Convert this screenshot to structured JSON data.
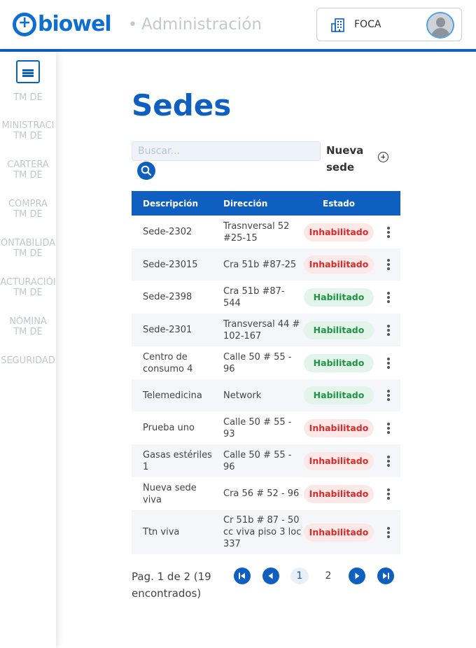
{
  "header": {
    "logo_text": "biowel",
    "section": "Administración",
    "org_name": "FOCA"
  },
  "sidebar": {
    "items": [
      {
        "l1": "TM DE",
        "l2": ""
      },
      {
        "l1": "MINISTRACI",
        "l2": "TM DE"
      },
      {
        "l1": "CARTERA",
        "l2": "TM DE"
      },
      {
        "l1": "COMPRA",
        "l2": "TM DE"
      },
      {
        "l1": "ONTABILIDA",
        "l2": "TM DE"
      },
      {
        "l1": "ACTURACIÓI",
        "l2": "TM DE"
      },
      {
        "l1": "NÓMINA",
        "l2": "TM DE"
      },
      {
        "l1": "SEGURIDAD",
        "l2": ""
      }
    ]
  },
  "page": {
    "title": "Sedes",
    "search_placeholder": "Buscar...",
    "new_label": "Nueva sede"
  },
  "table": {
    "columns": [
      "Descripción",
      "Dirección",
      "Estado"
    ],
    "rows": [
      {
        "desc": "Sede-2302",
        "dir": "Trasnversal 52 #25-15",
        "estado": "Inhabilitado"
      },
      {
        "desc": "Sede-23015",
        "dir": "Cra 51b #87-25",
        "estado": "Inhabilitado"
      },
      {
        "desc": "Sede-2398",
        "dir": "Cra 51b #87-544",
        "estado": "Habilitado"
      },
      {
        "desc": "Sede-2301",
        "dir": "Transversal 44 # 102-167",
        "estado": "Habilitado"
      },
      {
        "desc": "Centro de consumo 4",
        "dir": "Calle 50 # 55 - 96",
        "estado": "Habilitado"
      },
      {
        "desc": "Telemedicina",
        "dir": "Network",
        "estado": "Habilitado"
      },
      {
        "desc": "Prueba uno",
        "dir": "Calle 50 # 55 - 93",
        "estado": "Inhabilitado"
      },
      {
        "desc": "Gasas estériles 1",
        "dir": "Calle 50 # 55 - 96",
        "estado": "Inhabilitado"
      },
      {
        "desc": "Nueva sede viva",
        "dir": "Cra 56 # 52 - 96",
        "estado": "Inhabilitado"
      },
      {
        "desc": "Ttn viva",
        "dir": "Cr 51b # 87 - 50 cc viva piso 3 loc 337",
        "estado": "Inhabilitado"
      }
    ]
  },
  "pagination": {
    "info": "Pag. 1 de 2 (19 encontrados)",
    "pages": [
      "1",
      "2"
    ],
    "current": "1"
  },
  "colors": {
    "primary": "#0e5fbf",
    "enabled_text": "#1f9446",
    "disabled_text": "#d62b2b"
  }
}
